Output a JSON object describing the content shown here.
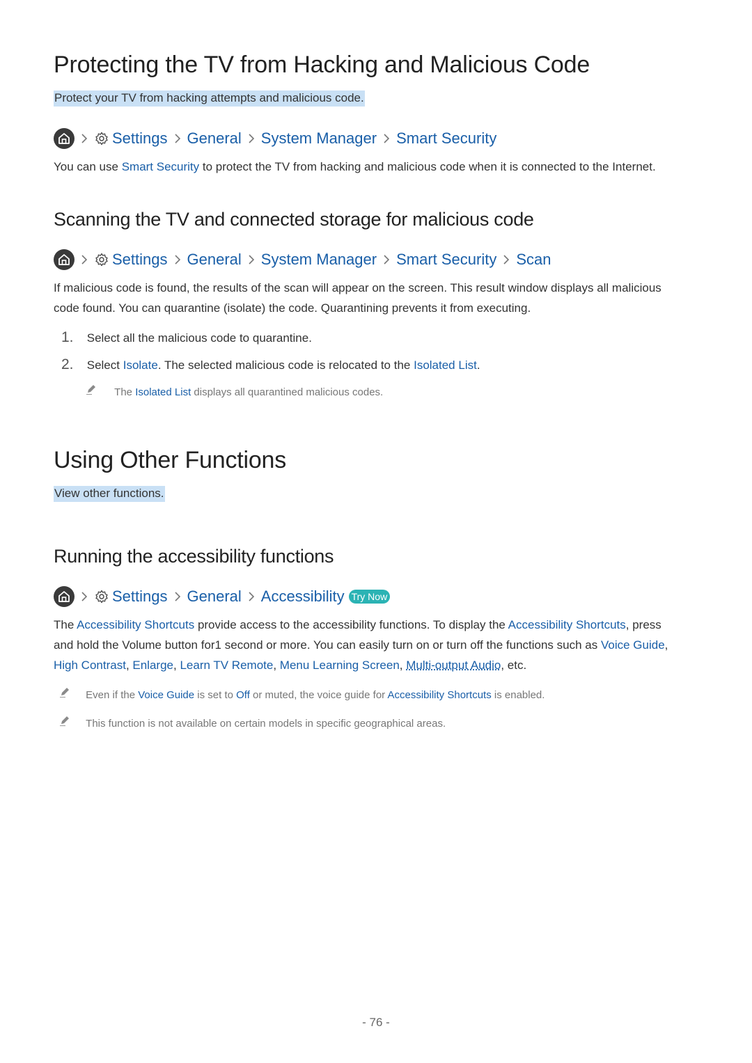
{
  "section1": {
    "title": "Protecting the TV from Hacking and Malicious Code",
    "intro": "Protect your TV from hacking attempts and malicious code.",
    "path": [
      "Settings",
      "General",
      "System Manager",
      "Smart Security"
    ],
    "body": {
      "pre": "You can use ",
      "link": "Smart Security",
      "post": " to protect the TV from hacking and malicious code when it is connected to the Internet."
    }
  },
  "section2": {
    "title": "Scanning the TV and connected storage for malicious code",
    "path": [
      "Settings",
      "General",
      "System Manager",
      "Smart Security",
      "Scan"
    ],
    "body_line1": "If malicious code is found, the results of the scan will appear on the screen. This result window displays all malicious",
    "body_line2": "code found. You can quarantine (isolate) the code. Quarantining prevents it from executing.",
    "steps": [
      {
        "num": "1.",
        "text": "Select all the malicious code to quarantine."
      },
      {
        "num": "2.",
        "pre": "Select ",
        "link1": "Isolate",
        "mid": ". The selected malicious code is relocated to the ",
        "link2": "Isolated List",
        "post": "."
      }
    ],
    "note": {
      "pre": "The ",
      "link": "Isolated List",
      "post": " displays all quarantined malicious codes."
    }
  },
  "section3": {
    "title": "Using Other Functions",
    "intro": "View other functions."
  },
  "section4": {
    "title": "Running the accessibility functions",
    "path": [
      "Settings",
      "General",
      "Accessibility"
    ],
    "try_now": "Try Now",
    "body": {
      "t1": "The ",
      "l1": "Accessibility Shortcuts",
      "t2": " provide access to the accessibility functions. To display the ",
      "l2": "Accessibility Shortcuts",
      "t3": ", press",
      "t4": "and hold the Volume button for1 second or more. You can easily turn on or turn off the functions such as ",
      "l3": "Voice Guide",
      "t5": ",",
      "l4": "High Contrast",
      "t6": ", ",
      "l5": "Enlarge",
      "t7": ", ",
      "l6": "Learn TV Remote",
      "t8": ", ",
      "l7": "Menu Learning Screen",
      "t9": ", ",
      "l8": "Multi-output Audio",
      "t10": ", etc."
    },
    "notes": [
      {
        "pre": "Even if the ",
        "link1": "Voice Guide",
        "mid1": " is set to ",
        "link2": "Off",
        "mid2": " or muted, the voice guide for ",
        "link3": "Accessibility Shortcuts",
        "post": " is enabled."
      },
      {
        "text": "This function is not available on certain models in specific geographical areas."
      }
    ]
  },
  "footer": {
    "page_number": "- 76 -"
  }
}
